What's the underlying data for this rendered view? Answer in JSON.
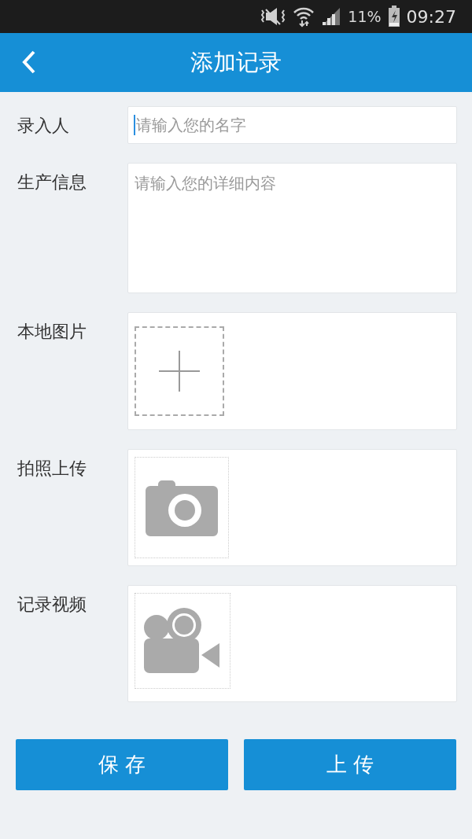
{
  "status_bar": {
    "battery": "11%",
    "time": "09:27"
  },
  "header": {
    "title": "添加记录"
  },
  "form": [
    {
      "kind": "input",
      "label": "录入人",
      "placeholder": "请输入您的名字",
      "focused": true
    },
    {
      "kind": "textarea",
      "label": "生产信息",
      "placeholder": "请输入您的详细内容"
    },
    {
      "kind": "add_image",
      "label": "本地图片"
    },
    {
      "kind": "photo",
      "label": "拍照上传"
    },
    {
      "kind": "video",
      "label": "记录视频"
    }
  ],
  "buttons": [
    "保 存",
    "上 传"
  ]
}
